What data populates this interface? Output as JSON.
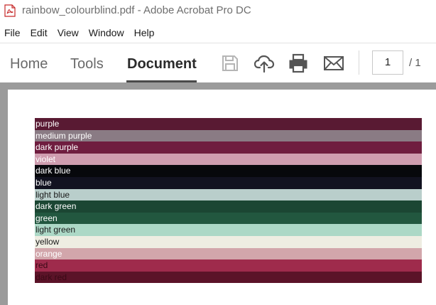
{
  "window": {
    "title": "rainbow_colourblind.pdf - Adobe Acrobat Pro DC"
  },
  "menu": [
    "File",
    "Edit",
    "View",
    "Window",
    "Help"
  ],
  "tabs": {
    "home": "Home",
    "tools": "Tools",
    "document": "Document"
  },
  "pager": {
    "current": "1",
    "total": "/ 1"
  },
  "swatches": [
    {
      "label": "purple",
      "bg": "#591a33",
      "fg": "#ffffff"
    },
    {
      "label": "medium purple",
      "bg": "#8a7b84",
      "fg": "#ffffff"
    },
    {
      "label": "dark purple",
      "bg": "#6f1d3f",
      "fg": "#ffffff"
    },
    {
      "label": "violet",
      "bg": "#cf9daf",
      "fg": "#ffffff"
    },
    {
      "label": "dark blue",
      "bg": "#07080c",
      "fg": "#ffffff"
    },
    {
      "label": "blue",
      "bg": "#121220",
      "fg": "#ffffff"
    },
    {
      "label": "light blue",
      "bg": "#b9cecb",
      "fg": "#1a1a1a"
    },
    {
      "label": "dark green",
      "bg": "#1b4633",
      "fg": "#ffffff"
    },
    {
      "label": "green",
      "bg": "#22573f",
      "fg": "#ffffff"
    },
    {
      "label": "light green",
      "bg": "#acd8c6",
      "fg": "#1a1a1a"
    },
    {
      "label": "yellow",
      "bg": "#eeede2",
      "fg": "#1a1a1a"
    },
    {
      "label": "orange",
      "bg": "#d2a6ab",
      "fg": "#ffffff"
    },
    {
      "label": "red",
      "bg": "#9f2b4c",
      "fg": "#3a0a16"
    },
    {
      "label": "dark red",
      "bg": "#5b1328",
      "fg": "#3a0a16"
    }
  ],
  "colors": {
    "acrobat_red": "#d32f2f",
    "viewer_gray": "#9b9b9b"
  }
}
